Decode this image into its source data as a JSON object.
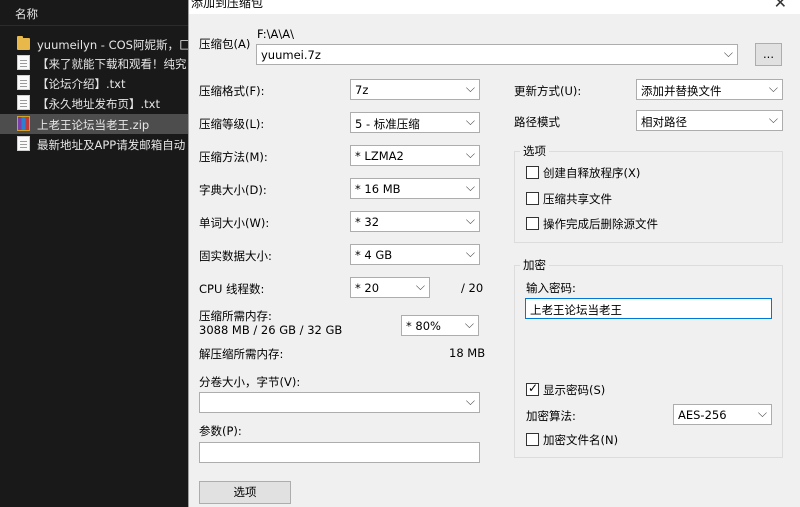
{
  "explorer": {
    "column_header": "名称",
    "items": [
      {
        "name": "yuumeilyn - COS阿妮斯，匚",
        "icon": "folder-icon"
      },
      {
        "name": "【来了就能下载和观看！纯究",
        "icon": "text-file-icon"
      },
      {
        "name": "【论坛介绍】.txt",
        "icon": "text-file-icon"
      },
      {
        "name": "【永久地址发布页】.txt",
        "icon": "text-file-icon"
      },
      {
        "name": "上老王论坛当老王.zip",
        "icon": "zip-archive-icon",
        "selected": true
      },
      {
        "name": "最新地址及APP请发邮箱自动",
        "icon": "text-file-icon"
      }
    ]
  },
  "dialog": {
    "title": "添加到压缩包",
    "archive": {
      "label": "压缩包(A)",
      "path": "F:\\A\\A\\",
      "filename": "yuumei.7z",
      "browse_label": "..."
    },
    "format": {
      "label": "压缩格式(F):",
      "value": "7z"
    },
    "level": {
      "label": "压缩等级(L):",
      "value": "5 - 标准压缩"
    },
    "method": {
      "label": "压缩方法(M):",
      "value": "* LZMA2"
    },
    "dict_size": {
      "label": "字典大小(D):",
      "value": "* 16 MB"
    },
    "word_size": {
      "label": "单词大小(W):",
      "value": "* 32"
    },
    "solid_size": {
      "label": "固实数据大小:",
      "value": "* 4 GB"
    },
    "cpu_threads": {
      "label": "CPU 线程数:",
      "value": "* 20",
      "max": "/ 20"
    },
    "memory": {
      "label": "压缩所需内存:",
      "detail": "3088 MB / 26 GB / 32 GB",
      "value": "* 80%"
    },
    "decomp_memory": {
      "label": "解压缩所需内存:",
      "value": "18 MB"
    },
    "volume": {
      "label": "分卷大小，字节(V):",
      "value": ""
    },
    "params": {
      "label": "参数(P):",
      "value": ""
    },
    "options_button": "选项",
    "update_mode": {
      "label": "更新方式(U):",
      "value": "添加并替换文件"
    },
    "path_mode": {
      "label": "路径模式",
      "value": "相对路径"
    },
    "options_group": {
      "title": "选项",
      "sfx": "创建自释放程序(X)",
      "shared": "压缩共享文件",
      "delete_after": "操作完成后删除源文件"
    },
    "encryption": {
      "title": "加密",
      "password_label": "输入密码:",
      "password_value": "上老王论坛当老王",
      "show_password": "显示密码(S)",
      "method_label": "加密算法:",
      "method_value": "AES-256",
      "encrypt_names": "加密文件名(N)"
    }
  }
}
